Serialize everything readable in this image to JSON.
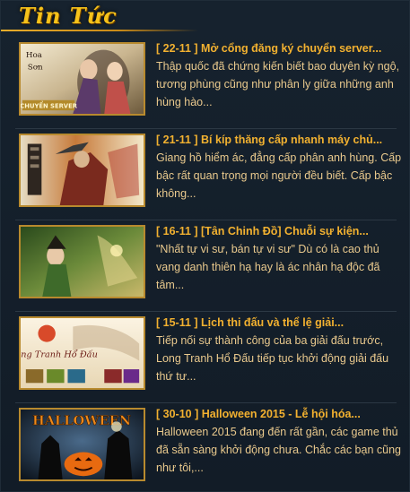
{
  "header": {
    "title": "Tin Tức"
  },
  "news": [
    {
      "title": "[ 22-11 ] Mở cổng đăng ký chuyển server...",
      "summary": "Thập quốc đã chứng kiến biết bao duyên kỳ ngộ, tương phùng cũng như phân ly giữa những anh hùng hào...",
      "thumb_caption": "CHUYỂN SERVER"
    },
    {
      "title": "[ 21-11 ] Bí kíp thăng cấp nhanh máy chủ...",
      "summary": "Giang hồ hiểm ác, đẳng cấp phân anh hùng. Cấp bậc rất quan trọng mọi người đều biết. Cấp bậc không...",
      "thumb_caption": ""
    },
    {
      "title": "[ 16-11 ] [Tân Chinh Đồ] Chuỗi sự kiện...",
      "summary": "\"Nhất tự vi sư, bán tự vi sư\" Dù có là cao thủ vang danh thiên hạ hay là ác nhân hạ độc đã tâm...",
      "thumb_caption": ""
    },
    {
      "title": "[ 15-11 ] Lịch thi đấu và thể lệ giải...",
      "summary": "Tiếp nối sự thành công của ba giải đấu trước, Long Tranh Hổ Đấu tiếp tục khởi động giải đấu thứ tư...",
      "thumb_caption": "Long Tranh Hổ Đấu"
    },
    {
      "title": "[ 30-10 ] Halloween 2015 - Lễ hội hóa...",
      "summary": "Halloween 2015 đang đến rất gần, các game thủ đã sẵn sàng khởi động chưa. Chắc các bạn cũng như tôi,...",
      "thumb_caption": "HALLOWEEN"
    }
  ],
  "colors": {
    "header_gold": "#f6c21a",
    "title": "#f2b130",
    "summary": "#e9c98d",
    "background": "#131e29"
  }
}
